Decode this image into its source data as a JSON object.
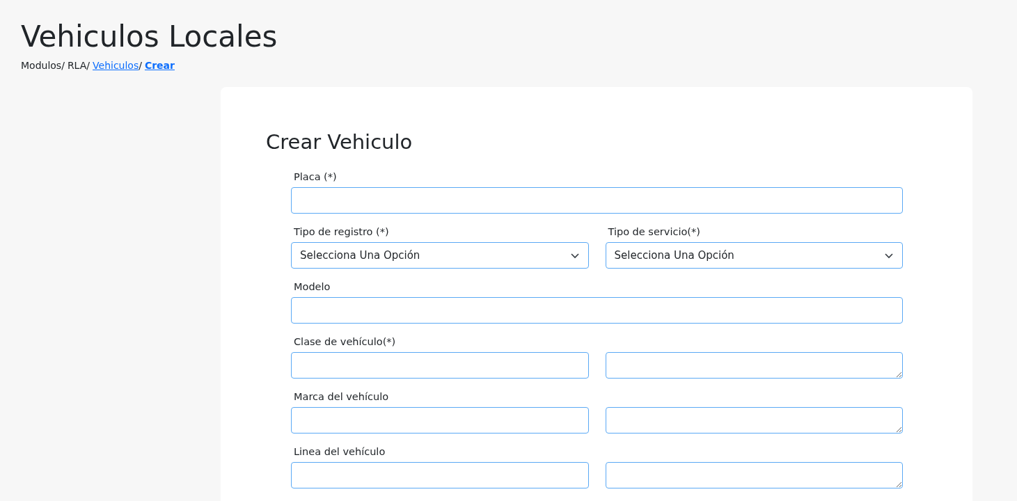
{
  "page": {
    "title": "Vehiculos Locales"
  },
  "breadcrumb": [
    {
      "label": "Modulos",
      "kind": "text",
      "separator": "/"
    },
    {
      "label": "RLA",
      "kind": "text",
      "separator": "/"
    },
    {
      "label": "Vehiculos",
      "kind": "link",
      "separator": "/"
    },
    {
      "label": "Crear",
      "kind": "current"
    }
  ],
  "form": {
    "title": "Crear Vehiculo",
    "rows": [
      {
        "kind": "input",
        "label": "Placa (*)"
      },
      {
        "kind": "select_pair",
        "fields": [
          {
            "label": "Tipo de registro (*)",
            "value": "Selecciona Una Opción"
          },
          {
            "label": "Tipo de servicio(*)",
            "value": "Selecciona Una Opción"
          }
        ]
      },
      {
        "kind": "input",
        "label": "Modelo"
      },
      {
        "kind": "input_textarea",
        "label": "Clase de vehículo(*)"
      },
      {
        "kind": "input_textarea",
        "label": "Marca del vehículo"
      },
      {
        "kind": "input_textarea",
        "label": "Linea del vehículo"
      }
    ]
  }
}
